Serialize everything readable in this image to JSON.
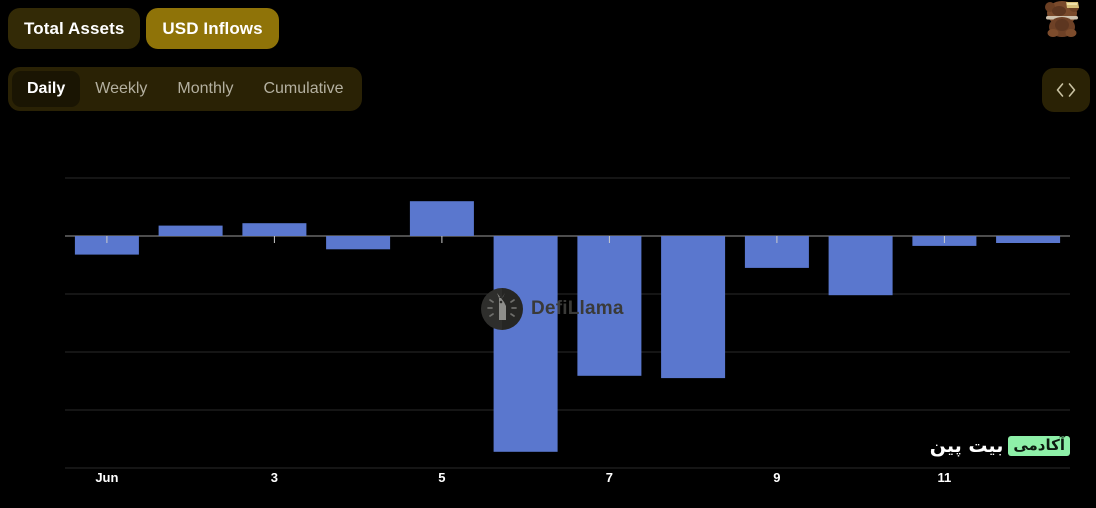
{
  "header": {
    "metrics": [
      {
        "label": "Total Assets",
        "active": false
      },
      {
        "label": "USD Inflows",
        "active": true
      }
    ],
    "periods": [
      {
        "label": "Daily",
        "active": true
      },
      {
        "label": "Weekly",
        "active": false
      },
      {
        "label": "Monthly",
        "active": false
      },
      {
        "label": "Cumulative",
        "active": false
      }
    ],
    "embed_label": "< >",
    "avatar_name": "bear-mascot-avatar"
  },
  "watermark": {
    "text": "DefiLlama"
  },
  "branding": {
    "badge_text": "آکادمی",
    "word_text": "بیت پین"
  },
  "colors": {
    "bar": "#5a77ce",
    "background": "#000000",
    "grid": "#2a2a2a",
    "axis": "#9a9a9a",
    "accent_active": "#8f7308",
    "accent_inactive": "#332a06",
    "badge_green": "#8ef0a8"
  },
  "chart_data": {
    "type": "bar",
    "title": "USD Inflows",
    "xlabel": "",
    "ylabel": "",
    "grid": true,
    "legend": "none",
    "zero_line": 0,
    "ylim": [
      -5.2,
      1.05
    ],
    "gridline_values": [
      1.0,
      0,
      -1.0,
      -2.0,
      -3.0,
      -4.0
    ],
    "categories": [
      "Jun 1",
      "Jun 2",
      "Jun 3",
      "Jun 4",
      "Jun 5",
      "Jun 6",
      "Jun 7",
      "Jun 8",
      "Jun 9",
      "Jun 10",
      "Jun 11",
      "Jun 12"
    ],
    "tick_labels": [
      "Jun",
      "3",
      "5",
      "7",
      "9",
      "11"
    ],
    "tick_categories": [
      "Jun 1",
      "Jun 3",
      "Jun 5",
      "Jun 7",
      "Jun 9",
      "Jun 11"
    ],
    "values": [
      -0.32,
      0.18,
      0.22,
      -0.23,
      0.6,
      -3.72,
      -2.41,
      -2.45,
      -0.55,
      -1.02,
      -0.17,
      -0.12
    ],
    "series": [
      {
        "name": "USD Inflows",
        "values": [
          -0.32,
          0.18,
          0.22,
          -0.23,
          0.6,
          -3.72,
          -2.41,
          -2.45,
          -0.55,
          -1.02,
          -0.17,
          -0.12
        ]
      }
    ]
  }
}
